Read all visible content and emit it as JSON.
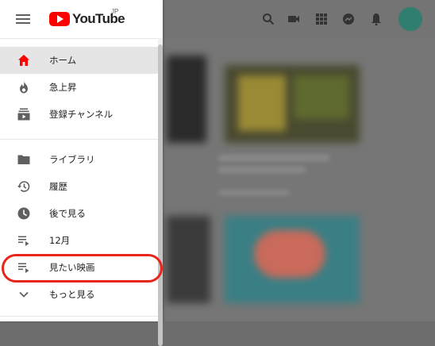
{
  "logo": {
    "wordmark": "YouTube",
    "country_code": "JP"
  },
  "topbar_icons": [
    "search-icon",
    "create-video-icon",
    "apps-icon",
    "messages-icon",
    "notifications-icon",
    "avatar"
  ],
  "drawer": {
    "primary": [
      {
        "icon": "home-icon",
        "label": "ホーム",
        "active": true
      },
      {
        "icon": "trending-icon",
        "label": "急上昇"
      },
      {
        "icon": "subscriptions-icon",
        "label": "登録チャンネル"
      }
    ],
    "library": [
      {
        "icon": "library-icon",
        "label": "ライブラリ"
      },
      {
        "icon": "history-icon",
        "label": "履歴"
      },
      {
        "icon": "watch-later-icon",
        "label": "後で見る"
      },
      {
        "icon": "playlist-icon",
        "label": "12月"
      },
      {
        "icon": "playlist-icon",
        "label": "見たい映画",
        "highlighted": true
      },
      {
        "icon": "chevron-down-icon",
        "label": "もっと見る"
      }
    ]
  },
  "colors": {
    "brand_red": "#ff0000",
    "highlight_ring": "#e8251a",
    "active_bg": "#e5e5e5"
  }
}
